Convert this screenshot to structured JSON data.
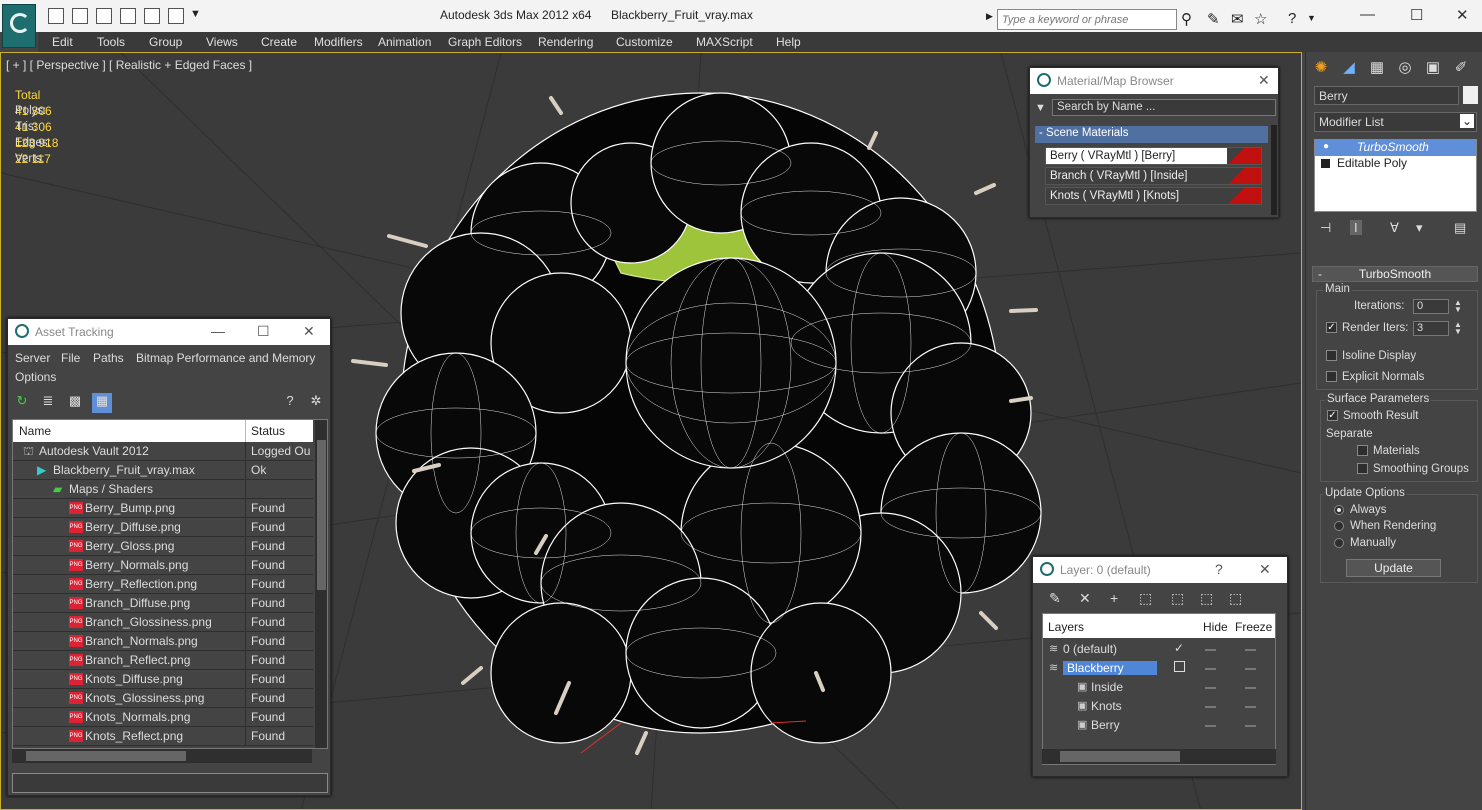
{
  "title_bar": {
    "app_title": "Autodesk 3ds Max  2012 x64",
    "file_name": "Blackberry_Fruit_vray.max",
    "search_placeholder": "Type a keyword or phrase"
  },
  "menu": [
    "Edit",
    "Tools",
    "Group",
    "Views",
    "Create",
    "Modifiers",
    "Animation",
    "Graph Editors",
    "Rendering",
    "Customize",
    "MAXScript",
    "Help"
  ],
  "viewport": {
    "label": "[ + ] [ Perspective ] [ Realistic + Edged Faces ]",
    "stats_header": "Total",
    "stats": [
      {
        "label": "Polys:",
        "value": "41 306"
      },
      {
        "label": "Tris:",
        "value": "41 306"
      },
      {
        "label": "Edges:",
        "value": "123 918"
      },
      {
        "label": "Verts:",
        "value": "22 117"
      }
    ]
  },
  "command_panel": {
    "object_name": "Berry",
    "modifier_list": "Modifier List",
    "stack": [
      "TurboSmooth",
      "Editable Poly"
    ],
    "rollout_title": "TurboSmooth",
    "main_group": "Main",
    "iterations_label": "Iterations:",
    "iterations_value": "0",
    "render_iters_label": "Render Iters:",
    "render_iters_value": "3",
    "isoline_label": "Isoline Display",
    "explicit_normals_label": "Explicit Normals",
    "surface_group": "Surface Parameters",
    "smooth_result_label": "Smooth Result",
    "separate_label": "Separate",
    "materials_label": "Materials",
    "smoothing_groups_label": "Smoothing Groups",
    "update_group": "Update Options",
    "always_label": "Always",
    "when_rendering_label": "When Rendering",
    "manually_label": "Manually",
    "update_button": "Update"
  },
  "material_browser": {
    "title": "Material/Map Browser",
    "search_placeholder": "Search by Name ...",
    "group": "- Scene Materials",
    "materials": [
      "Berry  ( VRayMtl )  [Berry]",
      "Branch  ( VRayMtl )  [Inside]",
      "Knots  ( VRayMtl )  [Knots]"
    ]
  },
  "asset_tracking": {
    "title": "Asset Tracking",
    "menu": [
      "Server",
      "File",
      "Paths",
      "Bitmap Performance and Memory",
      "Options"
    ],
    "col_name": "Name",
    "col_status": "Status",
    "rows": [
      {
        "name": "Autodesk Vault 2012",
        "status": "Logged Ou",
        "indent": 0,
        "kind": "vault"
      },
      {
        "name": "Blackberry_Fruit_vray.max",
        "status": "Ok",
        "indent": 1,
        "kind": "max"
      },
      {
        "name": "Maps / Shaders",
        "status": "",
        "indent": 2,
        "kind": "folder"
      },
      {
        "name": "Berry_Bump.png",
        "status": "Found",
        "indent": 3,
        "kind": "png"
      },
      {
        "name": "Berry_Diffuse.png",
        "status": "Found",
        "indent": 3,
        "kind": "png"
      },
      {
        "name": "Berry_Gloss.png",
        "status": "Found",
        "indent": 3,
        "kind": "png"
      },
      {
        "name": "Berry_Normals.png",
        "status": "Found",
        "indent": 3,
        "kind": "png"
      },
      {
        "name": "Berry_Reflection.png",
        "status": "Found",
        "indent": 3,
        "kind": "png"
      },
      {
        "name": "Branch_Diffuse.png",
        "status": "Found",
        "indent": 3,
        "kind": "png"
      },
      {
        "name": "Branch_Glossiness.png",
        "status": "Found",
        "indent": 3,
        "kind": "png"
      },
      {
        "name": "Branch_Normals.png",
        "status": "Found",
        "indent": 3,
        "kind": "png"
      },
      {
        "name": "Branch_Reflect.png",
        "status": "Found",
        "indent": 3,
        "kind": "png"
      },
      {
        "name": "Knots_Diffuse.png",
        "status": "Found",
        "indent": 3,
        "kind": "png"
      },
      {
        "name": "Knots_Glossiness.png",
        "status": "Found",
        "indent": 3,
        "kind": "png"
      },
      {
        "name": "Knots_Normals.png",
        "status": "Found",
        "indent": 3,
        "kind": "png"
      },
      {
        "name": "Knots_Reflect.png",
        "status": "Found",
        "indent": 3,
        "kind": "png"
      }
    ]
  },
  "layer_manager": {
    "title": "Layer: 0 (default)",
    "col_layers": "Layers",
    "col_hide": "Hide",
    "col_freeze": "Freeze",
    "layers": [
      "0 (default)",
      "Blackberry",
      "Inside",
      "Knots",
      "Berry"
    ]
  },
  "colors": {
    "accent_blue": "#5e8fd8",
    "stats_yellow": "#ffd83a",
    "material_red": "#c01010",
    "viewport_border": "#c9b22a"
  }
}
